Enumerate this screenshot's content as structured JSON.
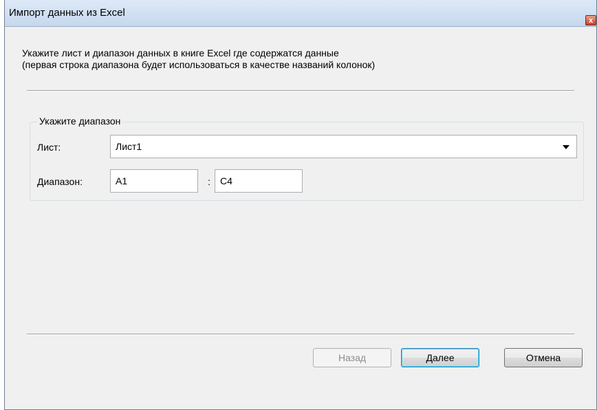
{
  "window": {
    "title": "Импорт данных из Excel",
    "close_glyph": "x"
  },
  "instructions": {
    "line1": "Укажите лист и диапазон данных в книге Excel где содержатся данные",
    "line2": "(первая строка диапазона будет использоваться в качестве названий колонок)"
  },
  "range_group": {
    "legend": "Укажите диапазон",
    "sheet_label": "Лист:",
    "sheet_value": "Лист1",
    "range_label": "Диапазон:",
    "range_from": "A1",
    "range_sep": ":",
    "range_to": "C4"
  },
  "buttons": {
    "back": "Назад",
    "next": "Далее",
    "cancel": "Отмена"
  }
}
